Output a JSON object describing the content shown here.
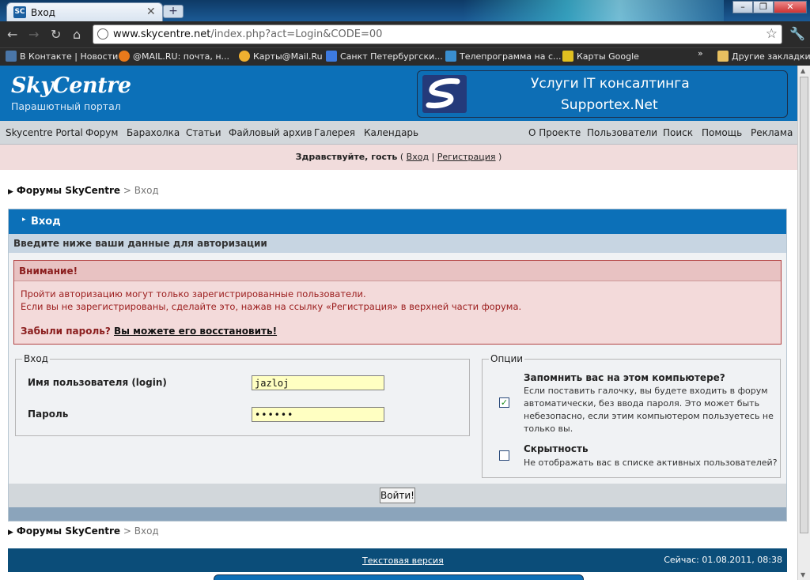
{
  "browser": {
    "tab_title": "Вход",
    "tab_favicon": "SC",
    "url_host": "www.skycentre.net",
    "url_path": "/index.php?act=Login&CODE=00",
    "bookmarks": [
      {
        "label": "В Контакте | Новости",
        "icon": "vk-icon",
        "color": "#4a76a8"
      },
      {
        "label": "@MAIL.RU: почта, н...",
        "icon": "mailru-icon",
        "color": "#e97a1b"
      },
      {
        "label": "Карты@Mail.Ru",
        "icon": "maps-mailru-icon",
        "color": "#f0b030"
      },
      {
        "label": "Санкт Петербургски...",
        "icon": "spb-icon",
        "color": "#3d7ae0"
      },
      {
        "label": "Телепрограмма на с...",
        "icon": "tv-icon",
        "color": "#3a8fd0"
      },
      {
        "label": "Карты Google",
        "icon": "google-maps-icon",
        "color": "#e0c020"
      }
    ],
    "other_bookmarks": "Другие закладки"
  },
  "site": {
    "logo": "SkyCentre",
    "logo_sub": "Парашютный портал",
    "banner_line1": "Услуги IT консалтинга",
    "banner_line2": "Supportex.Net",
    "nav_left": [
      "Skycentre Portal",
      "Форум",
      "Барахолка",
      "Статьи",
      "Файловый архив",
      "Галерея",
      "Календарь"
    ],
    "nav_right": [
      "О Проекте",
      "Пользователи",
      "Поиск",
      "Помощь",
      "Реклама"
    ],
    "welcome_text": "Здравствуйте, гость",
    "welcome_open": " ( ",
    "login_link": "Вход",
    "sep": " | ",
    "register_link": "Регистрация",
    "welcome_close": " )"
  },
  "breadcrumb": {
    "root": "Форумы SkyCentre",
    "sep": " > ",
    "current": "Вход"
  },
  "login": {
    "title": "Вход",
    "subtitle": "Введите ниже ваши данные для авторизации",
    "warning_title": "Внимание!",
    "warning_line1": "Пройти авторизацию могут только зарегистрированные пользователи.",
    "warning_line2": "Если вы не зарегистрированы, сделайте это, нажав на ссылку «Регистрация» в верхней части форума.",
    "forgot_q": "Забыли пароль?",
    "forgot_link": "Вы можете его восстановить!",
    "fieldset_login": "Вход",
    "username_label": "Имя пользователя (login)",
    "username_value": "jazloj",
    "password_label": "Пароль",
    "password_value": "••••••",
    "fieldset_options": "Опции",
    "remember_title": "Запомнить вас на этом компьютере?",
    "remember_desc": [
      "Если поставить галочку, вы будете входить в форум",
      "автоматически, без ввода пароля. Это может быть",
      "небезопасно, если этим компьютером пользуетесь не",
      "только вы."
    ],
    "remember_checked": true,
    "hidden_title": "Скрытность",
    "hidden_desc": "Не отображать вас в списке активных пользователей?",
    "hidden_checked": false,
    "submit": "Войти!"
  },
  "footer": {
    "text_version": "Текстовая версия",
    "time": "Сейчас: 01.08.2011, 08:38"
  }
}
